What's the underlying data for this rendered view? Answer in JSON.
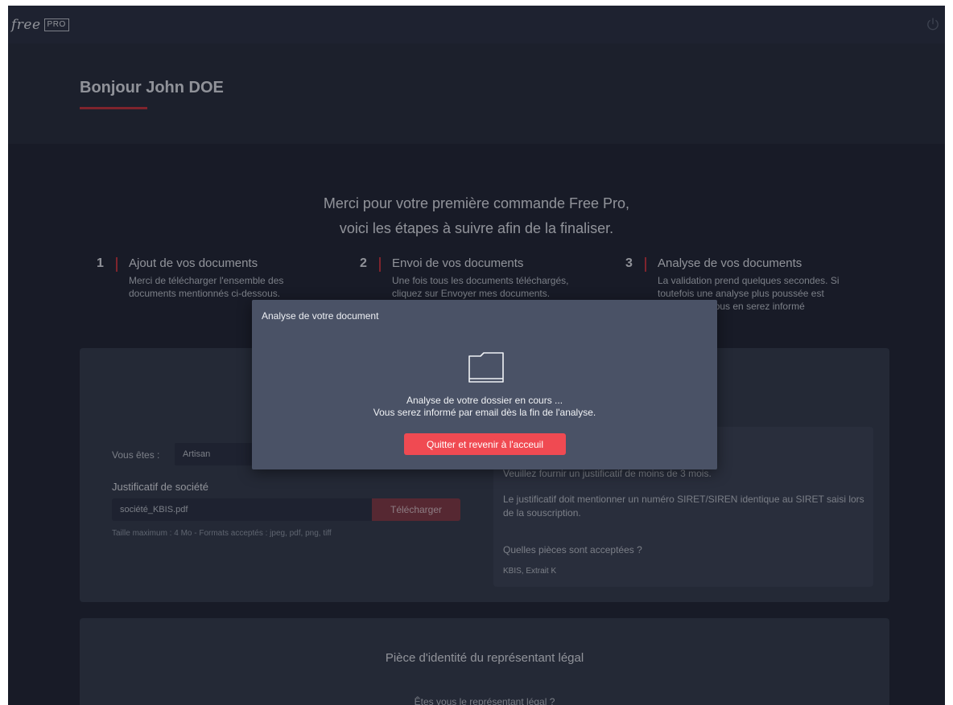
{
  "header": {
    "logo_free": "free",
    "logo_pro": "PRO",
    "power_icon": "power-icon"
  },
  "hero": {
    "greeting": "Bonjour John DOE"
  },
  "intro": {
    "line1": "Merci pour votre première commande Free Pro,",
    "line2": "voici les étapes à suivre afin de la finaliser."
  },
  "steps": [
    {
      "number": "1",
      "title": "Ajout de vos documents",
      "text": "Merci de télécharger l'ensemble des documents mentionnés ci-dessous."
    },
    {
      "number": "2",
      "title": "Envoi de vos documents",
      "text": "Une fois tous les documents téléchargés, cliquez sur Envoyer mes documents."
    },
    {
      "number": "3",
      "title": "Analyse de vos documents",
      "text": "La validation prend quelques secondes. Si toutefois une analyse plus poussée est nécessaire, vous en serez informé"
    }
  ],
  "company_card": {
    "you_are_label": "Vous êtes :",
    "you_are_value": "Artisan",
    "proof_title": "Justificatif de société",
    "file_name": "société_KBIS.pdf",
    "upload_label": "Télécharger",
    "hint": "Taille maximum : 4 Mo - Formats acceptés : jpeg, pdf, png, tiff",
    "info_line1": "Veuillez fournir un justificatif de moins de 3 mois.",
    "info_line2": "Le justificatif doit mentionner un numéro SIRET/SIREN identique au SIRET saisi lors de la souscription.",
    "info_question": "Quelles pièces sont acceptées ?",
    "info_answer": "KBIS, Extrait K"
  },
  "identity_card": {
    "title": "Pièce d'identité du représentant légal",
    "question": "Êtes vous le représentant légal ?"
  },
  "modal": {
    "title": "Analyse de votre document",
    "icon": "folder-icon",
    "line1": "Analyse de votre dossier en cours ...",
    "line2": "Vous serez informé par email dès la fin de l'analyse.",
    "button_label": "Quitter et revenir à l'acceuil"
  },
  "colors": {
    "accent_red": "#d0333c",
    "button_red": "#f04a52",
    "background": "#1f2431",
    "card": "#343b4b",
    "modal": "#4a5266"
  }
}
